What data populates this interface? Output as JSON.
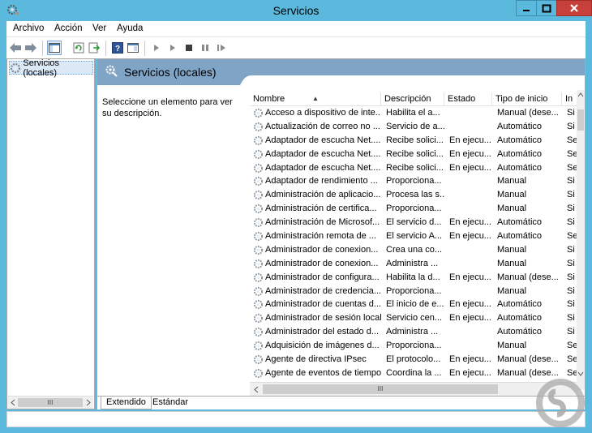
{
  "window": {
    "title": "Servicios"
  },
  "menu": [
    "Archivo",
    "Acción",
    "Ver",
    "Ayuda"
  ],
  "tree": {
    "item": "Servicios (locales)"
  },
  "main": {
    "header": "Servicios (locales)",
    "description": "Seleccione un elemento para ver su descripción."
  },
  "columns": [
    "Nombre",
    "Descripción",
    "Estado",
    "Tipo de inicio",
    "In"
  ],
  "rows": [
    {
      "name": "Acceso a dispositivo de inte...",
      "desc": "Habilita el a...",
      "state": "",
      "start": "Manual (dese...",
      "in": "Si"
    },
    {
      "name": "Actualización de correo no ...",
      "desc": "Servicio de a...",
      "state": "",
      "start": "Automático",
      "in": "Si"
    },
    {
      "name": "Adaptador de escucha Net....",
      "desc": "Recibe solici...",
      "state": "En ejecu...",
      "start": "Automático",
      "in": "Se"
    },
    {
      "name": "Adaptador de escucha Net....",
      "desc": "Recibe solici...",
      "state": "En ejecu...",
      "start": "Automático",
      "in": "Se"
    },
    {
      "name": "Adaptador de escucha Net....",
      "desc": "Recibe solici...",
      "state": "En ejecu...",
      "start": "Automático",
      "in": "Se"
    },
    {
      "name": "Adaptador de rendimiento ...",
      "desc": "Proporciona...",
      "state": "",
      "start": "Manual",
      "in": "Si"
    },
    {
      "name": "Administración de aplicacio...",
      "desc": "Procesa las s...",
      "state": "",
      "start": "Manual",
      "in": "Si"
    },
    {
      "name": "Administración de certifica...",
      "desc": "Proporciona...",
      "state": "",
      "start": "Manual",
      "in": "Si"
    },
    {
      "name": "Administración de Microsof...",
      "desc": "El servicio d...",
      "state": "En ejecu...",
      "start": "Automático",
      "in": "Si"
    },
    {
      "name": "Administración remota de ...",
      "desc": "El servicio A...",
      "state": "En ejecu...",
      "start": "Automático",
      "in": "Se"
    },
    {
      "name": "Administrador de conexion...",
      "desc": "Crea una co...",
      "state": "",
      "start": "Manual",
      "in": "Si"
    },
    {
      "name": "Administrador de conexion...",
      "desc": "Administra ...",
      "state": "",
      "start": "Manual",
      "in": "Si"
    },
    {
      "name": "Administrador de configura...",
      "desc": "Habilita la d...",
      "state": "En ejecu...",
      "start": "Manual (dese...",
      "in": "Si"
    },
    {
      "name": "Administrador de credencia...",
      "desc": "Proporciona...",
      "state": "",
      "start": "Manual",
      "in": "Si"
    },
    {
      "name": "Administrador de cuentas d...",
      "desc": "El inicio de e...",
      "state": "En ejecu...",
      "start": "Automático",
      "in": "Si"
    },
    {
      "name": "Administrador de sesión local",
      "desc": "Servicio cen...",
      "state": "En ejecu...",
      "start": "Automático",
      "in": "Si"
    },
    {
      "name": "Administrador del estado d...",
      "desc": "Administra ...",
      "state": "",
      "start": "Automático",
      "in": "Si"
    },
    {
      "name": "Adquisición de imágenes d...",
      "desc": "Proporciona...",
      "state": "",
      "start": "Manual",
      "in": "Se"
    },
    {
      "name": "Agente de directiva IPsec",
      "desc": "El protocolo...",
      "state": "En ejecu...",
      "start": "Manual (dese...",
      "in": "Se"
    },
    {
      "name": "Agente de eventos de tiempo",
      "desc": "Coordina la ...",
      "state": "En ejecu...",
      "start": "Manual (dese...",
      "in": "Se"
    }
  ],
  "tabs": [
    "Extendido",
    "Estándar"
  ],
  "scroll": {
    "grip": "III"
  },
  "icons": {
    "app": "services-gear-icon",
    "row": "service-gear-icon"
  },
  "colors": {
    "titlebar": "#5ab9dc",
    "header": "#7fa4c6",
    "close": "#c7403a"
  }
}
